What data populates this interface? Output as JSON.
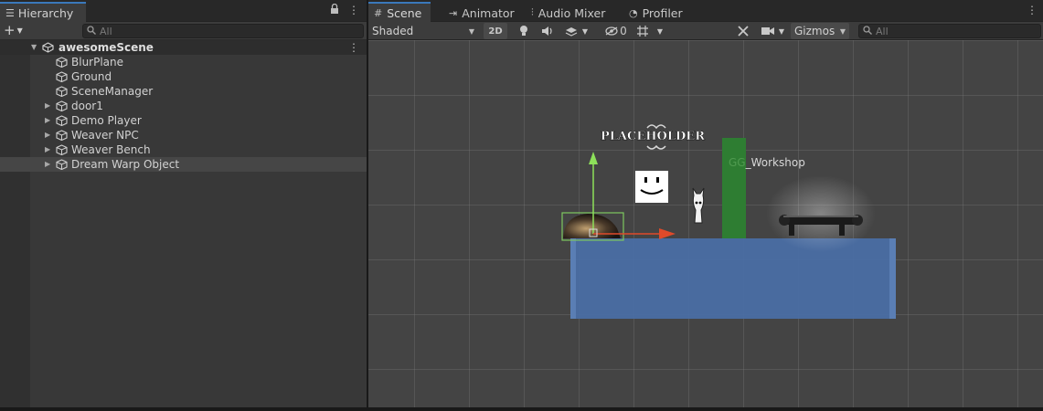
{
  "hierarchy": {
    "tab_label": "Hierarchy",
    "tab_icon": "list-icon",
    "search_placeholder": "All",
    "add_label": "+",
    "scene": {
      "name": "awesomeScene"
    },
    "items": [
      {
        "label": "BlurPlane",
        "expandable": false
      },
      {
        "label": "Ground",
        "expandable": false
      },
      {
        "label": "SceneManager",
        "expandable": false
      },
      {
        "label": "door1",
        "expandable": true
      },
      {
        "label": "Demo Player",
        "expandable": true
      },
      {
        "label": "Weaver NPC",
        "expandable": true
      },
      {
        "label": "Weaver Bench",
        "expandable": true
      },
      {
        "label": "Dream Warp Object",
        "expandable": true,
        "selected": true
      }
    ]
  },
  "scene_view": {
    "tabs": [
      {
        "label": "Scene",
        "icon": "grid-icon",
        "active": true
      },
      {
        "label": "Animator",
        "icon": "animator-icon"
      },
      {
        "label": "Audio Mixer",
        "icon": "audio-mixer-icon"
      },
      {
        "label": "Profiler",
        "icon": "profiler-icon"
      }
    ],
    "shading_mode": "Shaded",
    "mode_2d_label": "2D",
    "hidden_count": "0",
    "gizmos_label": "Gizmos",
    "search_placeholder": "All",
    "objects": {
      "placeholder_text": "PLACEHOLDER",
      "workshop_label_prefix": "GG",
      "workshop_label_suffix": "_Workshop"
    },
    "colors": {
      "ground": "#4a6ea4",
      "workshop_pillar": "#2e7d32",
      "gizmo_y": "#8de05a",
      "gizmo_x": "#e04a2a",
      "selection": "#7ec860",
      "accent": "#3a79bb"
    }
  }
}
